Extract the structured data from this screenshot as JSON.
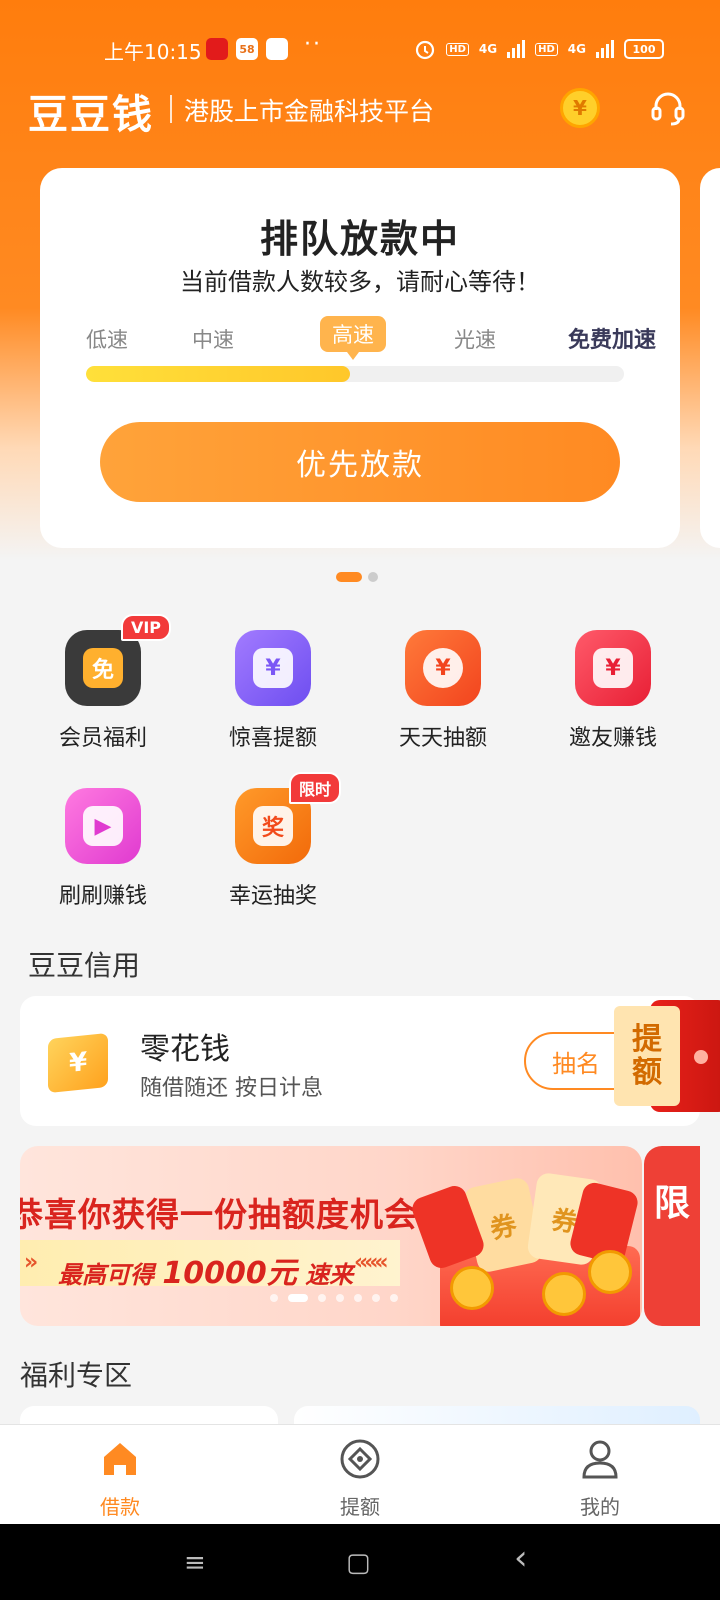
{
  "status_bar": {
    "time": "上午10:15",
    "mini_apps": [
      "",
      "58",
      ""
    ],
    "dots": "··",
    "network_1": "4G",
    "network_2": "4G",
    "hd": "HD",
    "battery": "100"
  },
  "header": {
    "logo": "豆豆钱",
    "slogan": "港股上市金融科技平台",
    "coin_symbol": "¥"
  },
  "loan_card": {
    "title": "排队放款中",
    "subtitle": "当前借款人数较多，请耐心等待！",
    "speeds": [
      "低速",
      "中速",
      "高速",
      "光速"
    ],
    "active_speed": "高速",
    "free_boost": "免费加速",
    "progress_fraction": 0.49,
    "button": "优先放款"
  },
  "features": [
    {
      "label": "会员福利",
      "badge": "VIP",
      "glyph": "免"
    },
    {
      "label": "惊喜提额",
      "badge": "",
      "glyph": "¥"
    },
    {
      "label": "天天抽额",
      "badge": "",
      "glyph": "¥"
    },
    {
      "label": "邀友赚钱",
      "badge": "",
      "glyph": "¥"
    },
    {
      "label": "刷刷赚钱",
      "badge": "",
      "glyph": "▶"
    },
    {
      "label": "幸运抽奖",
      "badge": "限时",
      "glyph": "奖"
    }
  ],
  "credit_section": {
    "title": "豆豆信用",
    "product_name": "零花钱",
    "product_desc": "随借随还 按日计息",
    "icon_symbol": "¥",
    "button": "抽名",
    "raise_tag": [
      "提",
      "额"
    ]
  },
  "promo": {
    "title": "恭喜你获得一份抽额度机会",
    "sub_prefix": "最高可得",
    "sub_amount": "10000元",
    "sub_suffix": "速来",
    "arrows_left": "»",
    "arrows_right": "«««",
    "peek_text": "限",
    "coupon_text": "券"
  },
  "welfare_section": {
    "title": "福利专区"
  },
  "bottom_nav": {
    "items": [
      "借款",
      "提额",
      "我的"
    ],
    "active": "借款"
  },
  "system_nav": {
    "menu": "≡",
    "home": "▢",
    "back": "‹"
  },
  "colors": {
    "brand_orange": "#ff8a22",
    "progress_yellow": "#ffd02a",
    "alert_red": "#f23a3a"
  }
}
